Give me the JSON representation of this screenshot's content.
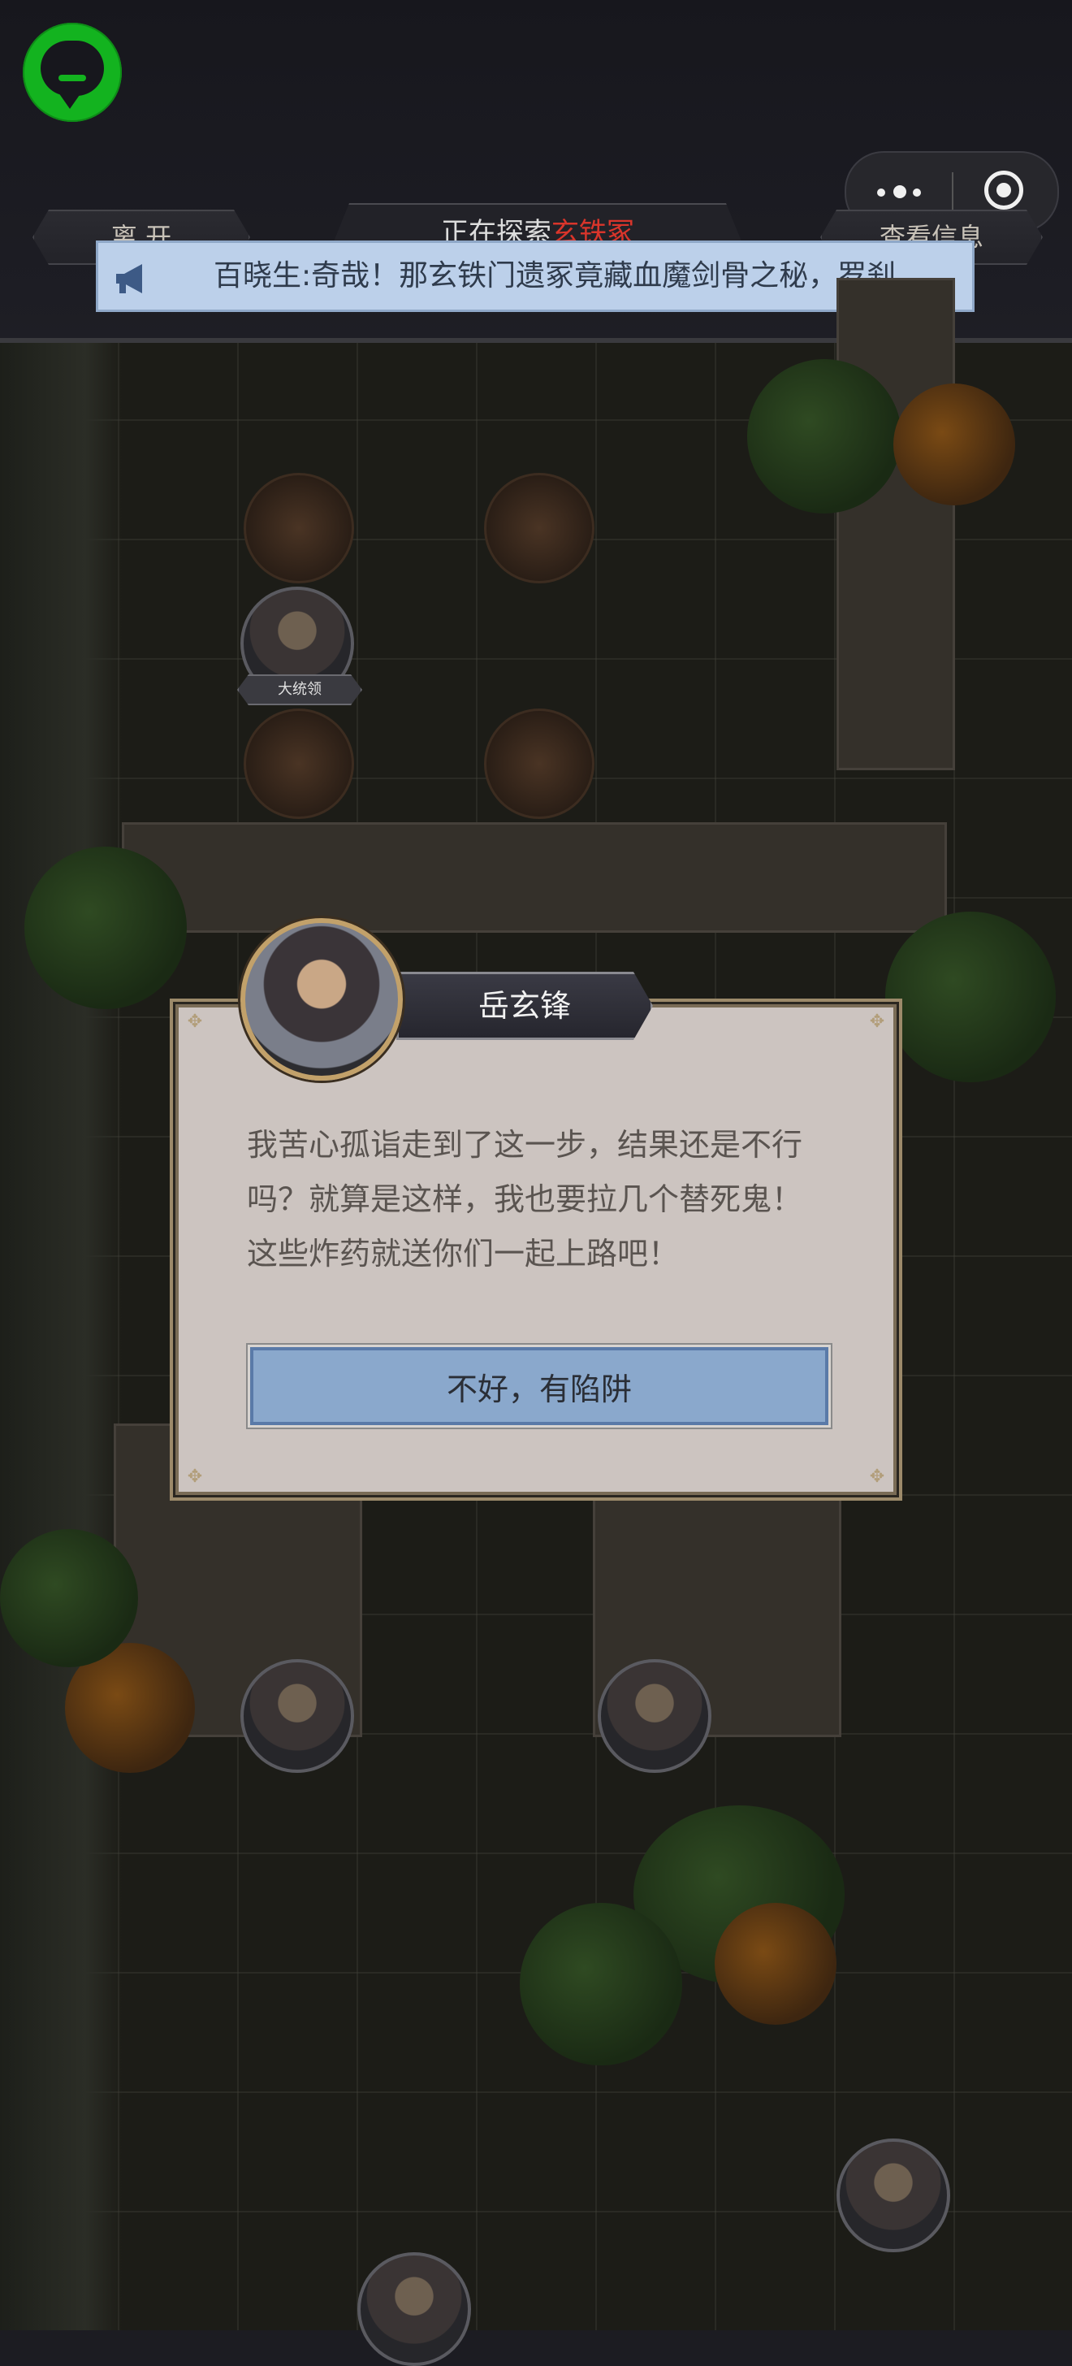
{
  "header": {
    "leave_label": "离 开",
    "explore_prefix": "正在探索",
    "explore_place": "玄铁冢",
    "info_label": "查看信息"
  },
  "announcement": {
    "text": "百晓生:奇哉！那玄铁门遗冢竟藏血魔剑骨之秘，罗刹"
  },
  "map": {
    "enemy_label": "大统领"
  },
  "dialog": {
    "speaker": "岳玄锋",
    "message": "我苦心孤诣走到了这一步，结果还是不行吗？就算是这样，我也要拉几个替死鬼！这些炸药就送你们一起上路吧！",
    "action_label": "不好，有陷阱"
  },
  "colors": {
    "accent_green": "#13b31f",
    "highlight_red": "#d9352b",
    "banner_blue": "#bcd0ea",
    "button_blue": "#8aa8cc"
  },
  "icons": [
    "app-logo-icon",
    "more-icon",
    "close-mini-program-icon",
    "megaphone-icon"
  ]
}
